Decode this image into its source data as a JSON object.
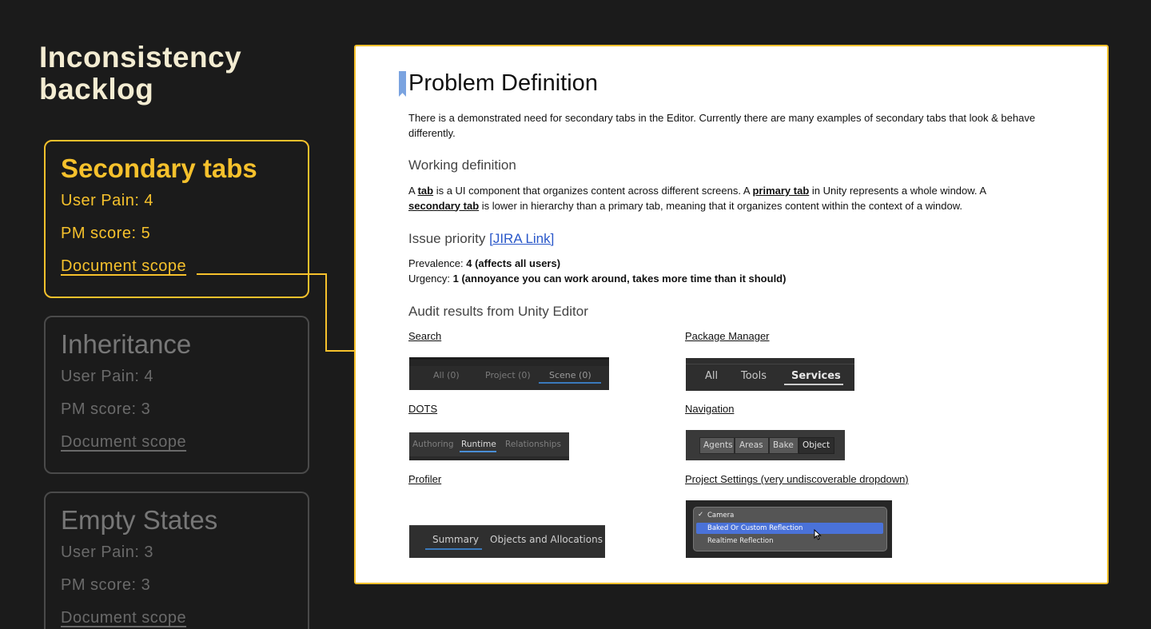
{
  "page": {
    "title": "Inconsistency backlog"
  },
  "cards": [
    {
      "title": "Secondary tabs",
      "user_pain": "User Pain: 4",
      "pm_score": "PM score: 5",
      "link": "Document scope"
    },
    {
      "title": "Inheritance",
      "user_pain": "User Pain: 4",
      "pm_score": "PM score: 3",
      "link": "Document scope"
    },
    {
      "title": "Empty States",
      "user_pain": "User Pain: 3",
      "pm_score": "PM score: 3",
      "link": "Document scope"
    }
  ],
  "doc": {
    "title": "Problem Definition",
    "intro": "There is a demonstrated need for secondary tabs in the Editor. Currently there are many examples of secondary tabs that look & behave differently.",
    "working_heading": "Working definition",
    "def": {
      "a": "A ",
      "tab": "tab",
      "mid1": " is a UI component that organizes content across different screens. A ",
      "primary": "primary tab",
      "mid2": " in Unity represents a whole window. A ",
      "secondary": "secondary tab",
      "end": " is lower in hierarchy than a primary tab, meaning that it organizes content within the context of a window."
    },
    "priority_heading": "Issue priority ",
    "jira_link": "[JIRA Link]",
    "prevalence_label": "Prevalence: ",
    "prevalence_value": "4 (affects all users)",
    "urgency_label": "Urgency: ",
    "urgency_value": "1 (annoyance you can work around, takes more time than it should)",
    "audit_heading": "Audit results from Unity Editor",
    "sections": {
      "search": {
        "label": "Search",
        "tabs": [
          "All (0)",
          "Project (0)",
          "Scene (0)"
        ]
      },
      "package": {
        "label": "Package Manager",
        "tabs": [
          "All",
          "Tools",
          "Services"
        ]
      },
      "dots": {
        "label": "DOTS",
        "tabs": [
          "Authoring",
          "Runtime",
          "Relationships"
        ]
      },
      "navigation": {
        "label": "Navigation",
        "tabs": [
          "Agents",
          "Areas",
          "Bake",
          "Object"
        ]
      },
      "profiler": {
        "label": "Profiler",
        "tabs": [
          "Summary",
          "Objects and Allocations"
        ]
      },
      "project_settings": {
        "label": "Project Settings (very undiscoverable dropdown)",
        "items": [
          "Camera",
          "Baked Or Custom Reflection",
          "Realtime Reflection"
        ],
        "check": "✓"
      }
    }
  },
  "colors": {
    "accent": "#f6c12c",
    "background": "#1b1b1b",
    "link": "#2957c9"
  }
}
